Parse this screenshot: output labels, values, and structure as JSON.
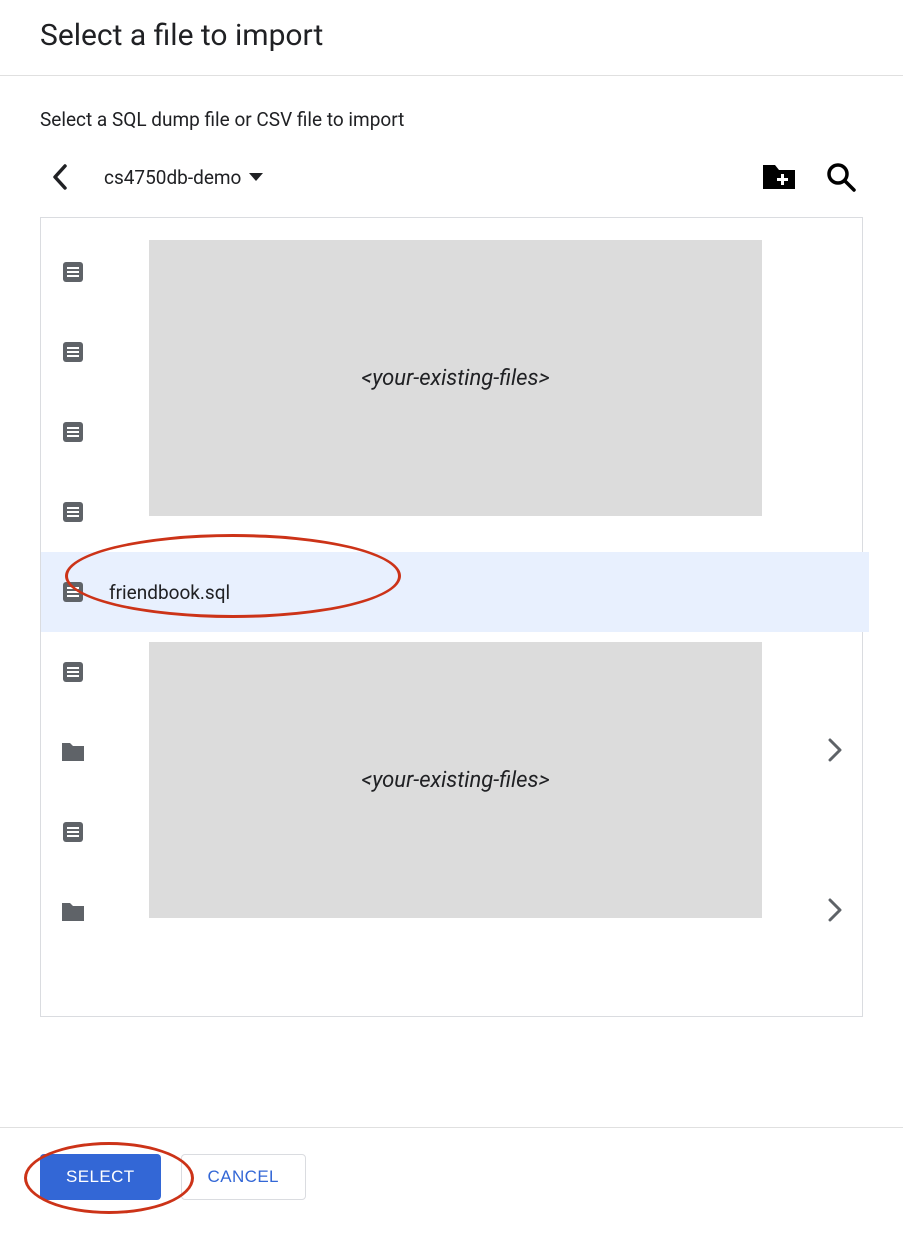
{
  "header": {
    "title": "Select a file to import"
  },
  "subtitle": "Select a SQL dump file or CSV file to import",
  "breadcrumb": {
    "current": "cs4750db-demo"
  },
  "placeholder_text": "<your-existing-files>",
  "files": [
    {
      "type": "file",
      "name": "",
      "nav": false
    },
    {
      "type": "file",
      "name": "",
      "nav": false
    },
    {
      "type": "file",
      "name": "",
      "nav": false
    },
    {
      "type": "file",
      "name": "",
      "nav": false
    },
    {
      "type": "file",
      "name": "friendbook.sql",
      "nav": false,
      "selected": true
    },
    {
      "type": "file",
      "name": "",
      "nav": false
    },
    {
      "type": "folder",
      "name": "",
      "nav": true
    },
    {
      "type": "file",
      "name": "",
      "nav": false
    },
    {
      "type": "folder",
      "name": "",
      "nav": true
    }
  ],
  "buttons": {
    "select": "SELECT",
    "cancel": "CANCEL"
  }
}
